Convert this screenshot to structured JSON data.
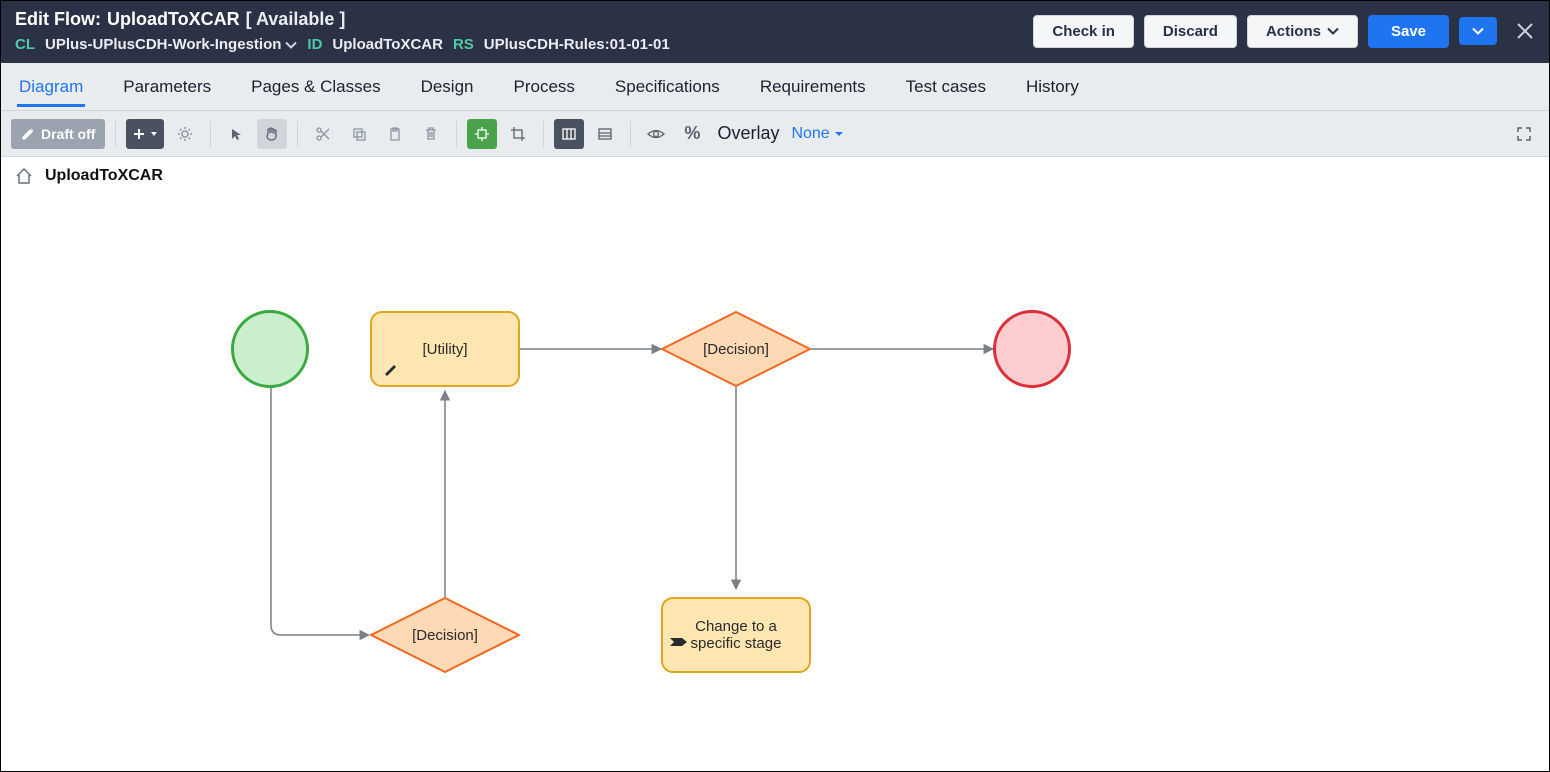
{
  "header": {
    "title_label": "Edit  Flow:",
    "title_name": "UploadToXCAR",
    "title_status": "[ Available ]",
    "meta": {
      "cl_key": "CL",
      "cl_val": "UPlus-UPlusCDH-Work-Ingestion",
      "id_key": "ID",
      "id_val": "UploadToXCAR",
      "rs_key": "RS",
      "rs_val": "UPlusCDH-Rules:01-01-01"
    },
    "buttons": {
      "checkin": "Check in",
      "discard": "Discard",
      "actions": "Actions",
      "save": "Save"
    }
  },
  "tabs": [
    "Diagram",
    "Parameters",
    "Pages & Classes",
    "Design",
    "Process",
    "Specifications",
    "Requirements",
    "Test cases",
    "History"
  ],
  "toolbar": {
    "draft": "Draft off",
    "overlay_label": "Overlay",
    "overlay_value": "None"
  },
  "breadcrumb": {
    "name": "UploadToXCAR"
  },
  "flow": {
    "utility": "[Utility]",
    "decision1": "[Decision]",
    "decision2": "[Decision]",
    "stage": "Change to a specific stage"
  }
}
